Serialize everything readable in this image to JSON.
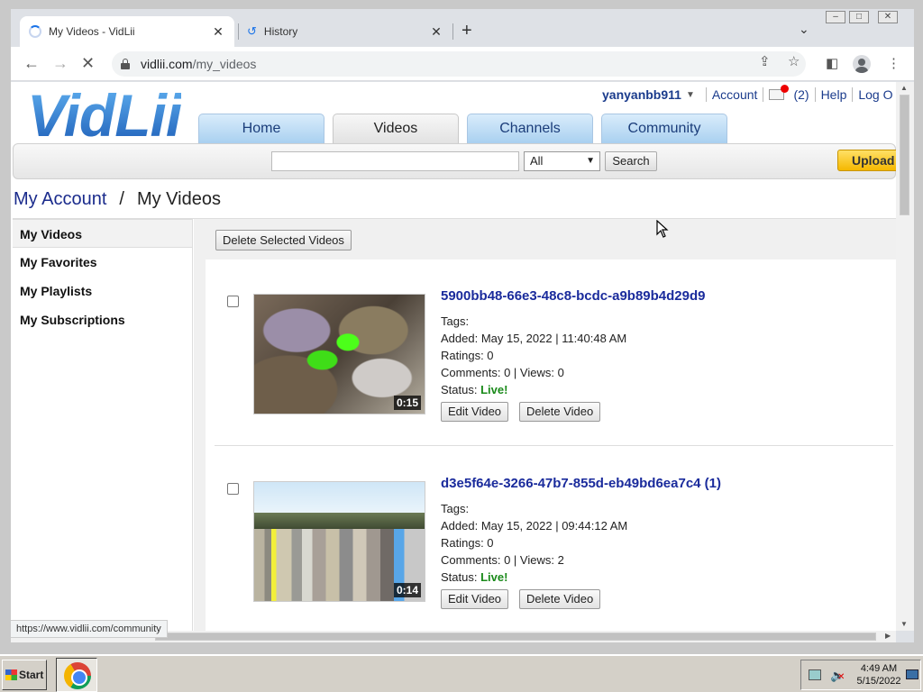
{
  "browser": {
    "tabs": [
      {
        "title": "My Videos - VidLii"
      },
      {
        "title": "History"
      }
    ],
    "new_tab_symbol": "+",
    "url_host": "vidlii.com",
    "url_path": "/my_videos",
    "status_tooltip": "https://www.vidlii.com/community"
  },
  "site": {
    "logo": "VidLii",
    "username": "yanyanbb911",
    "account_link": "Account",
    "mail_count": "(2)",
    "help_link": "Help",
    "logout_link": "Log O",
    "nav_tabs": [
      "Home",
      "Videos",
      "Channels",
      "Community"
    ],
    "search": {
      "category_selected": "All",
      "button_label": "Search"
    },
    "upload_label": "Upload"
  },
  "breadcrumb": {
    "parent": "My Account",
    "separator": "/",
    "current": "My Videos"
  },
  "sidebar": {
    "items": [
      "My Videos",
      "My Favorites",
      "My Playlists",
      "My Subscriptions"
    ]
  },
  "main": {
    "delete_selected_label": "Delete Selected Videos",
    "videos": [
      {
        "title": "5900bb48-66e3-48c8-bcdc-a9b89b4d29d9",
        "duration": "0:15",
        "tags": "Tags:",
        "added": "Added: May 15, 2022 | 11:40:48 AM",
        "ratings": "Ratings: 0",
        "comments_views": "Comments: 0 | Views: 0",
        "status_label": "Status:",
        "status_value": "Live!",
        "edit_label": "Edit Video",
        "delete_label": "Delete Video"
      },
      {
        "title": "d3e5f64e-3266-47b7-855d-eb49bd6ea7c4 (1)",
        "duration": "0:14",
        "tags": "Tags:",
        "added": "Added: May 15, 2022 | 09:44:12 AM",
        "ratings": "Ratings: 0",
        "comments_views": "Comments: 0 | Views: 2",
        "status_label": "Status:",
        "status_value": "Live!",
        "edit_label": "Edit Video",
        "delete_label": "Delete Video"
      }
    ]
  },
  "taskbar": {
    "start_label": "Start",
    "clock_time": "4:49 AM",
    "clock_date": "5/15/2022"
  },
  "colors": {
    "link_blue": "#1a2b9c",
    "live_green": "#1a8a1a",
    "upload_yellow": "#f5b800"
  }
}
